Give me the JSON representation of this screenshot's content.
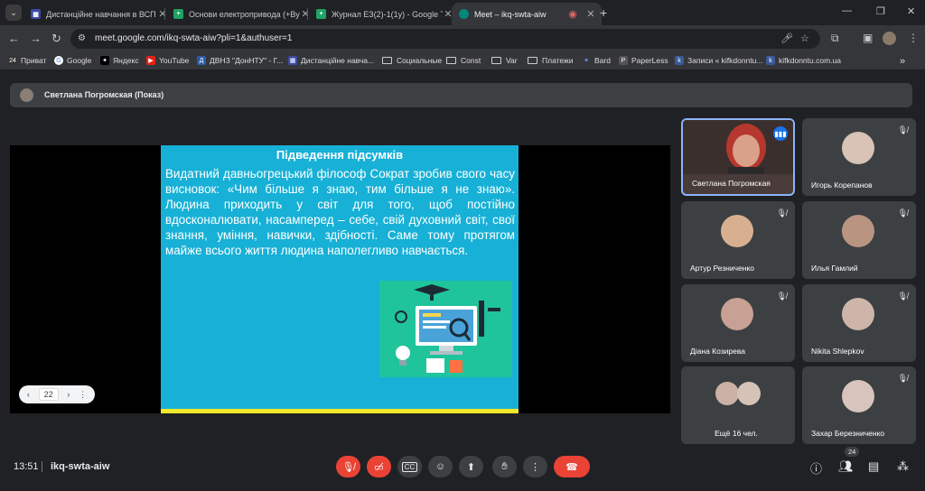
{
  "browser": {
    "tabs": [
      {
        "title": "Дистанційне навчання в ВСП",
        "favicon_color": "#3b4aa3",
        "favicon_glyph": "▦"
      },
      {
        "title": "Основи електропривода (+Ву",
        "favicon_color": "#1ea362",
        "favicon_glyph": "+"
      },
      {
        "title": "Журнал ЕЗ(2)-1(1у) - Google Т",
        "favicon_color": "#1ea362",
        "favicon_glyph": "+"
      },
      {
        "title": "Meet – ikq-swta-aiw",
        "favicon_color": "#00897b",
        "favicon_glyph": "●"
      }
    ],
    "url": "meet.google.com/ikq-swta-aiw?pli=1&authuser=1",
    "bookmarks": [
      {
        "label": "Приват",
        "kind": "icon",
        "color": "#333"
      },
      {
        "label": "Google",
        "kind": "icon",
        "color": "#4285f4"
      },
      {
        "label": "Яндекс",
        "kind": "icon",
        "color": "#000"
      },
      {
        "label": "YouTube",
        "kind": "icon",
        "color": "#e62117"
      },
      {
        "label": "ДВНЗ \"ДонНТУ\" - Г...",
        "kind": "icon",
        "color": "#2b5aa8"
      },
      {
        "label": "Дистанційне навча...",
        "kind": "icon",
        "color": "#3b4aa3"
      },
      {
        "label": "Социальные",
        "kind": "folder"
      },
      {
        "label": "Const",
        "kind": "folder"
      },
      {
        "label": "Var",
        "kind": "folder"
      },
      {
        "label": "Платежи",
        "kind": "folder"
      },
      {
        "label": "Bard",
        "kind": "icon",
        "color": "#4f7be8"
      },
      {
        "label": "PaperLess",
        "kind": "icon",
        "color": "#555"
      },
      {
        "label": "Записи « kifkdonntu...",
        "kind": "icon",
        "color": "#3b5998"
      },
      {
        "label": "kifkdonntu.com.ua",
        "kind": "icon",
        "color": "#3b5998"
      }
    ]
  },
  "meet": {
    "presenter_label": "Светлана Погромская (Показ)",
    "slide": {
      "title": "Підведення підсумків",
      "body": "Видатний давньогрецький філософ Сократ зробив свого часу висновок: «Чим більше я знаю, тим більше я не знаю». Людина приходить у світ для того, щоб постійно вдосконалювати, насамперед – себе, свій духовний світ, свої знання, уміння, навички, здібності. Саме тому протягом майже всього життя людина наполегливо навчається.",
      "page": "22"
    },
    "participants": [
      {
        "name": "Светлана Погромская",
        "speaking": true
      },
      {
        "name": "Игорь Корепанов",
        "face": "#d9c3b5"
      },
      {
        "name": "Артур Резниченко",
        "face": "#d8b08f"
      },
      {
        "name": "Илья Гамлий",
        "face": "#b99581"
      },
      {
        "name": "Діана Козирева",
        "face": "#c9a094"
      },
      {
        "name": "Nikita Shlepkov",
        "face": "#cdb5aa"
      },
      {
        "name": "Ещё 16 чел.",
        "face": "#d6c3b8"
      },
      {
        "name": "Захар Березниченко",
        "face": "#d8c4bc"
      }
    ],
    "time": "13:51",
    "meeting_code": "ikq-swta-aiw",
    "participant_count": "24"
  }
}
